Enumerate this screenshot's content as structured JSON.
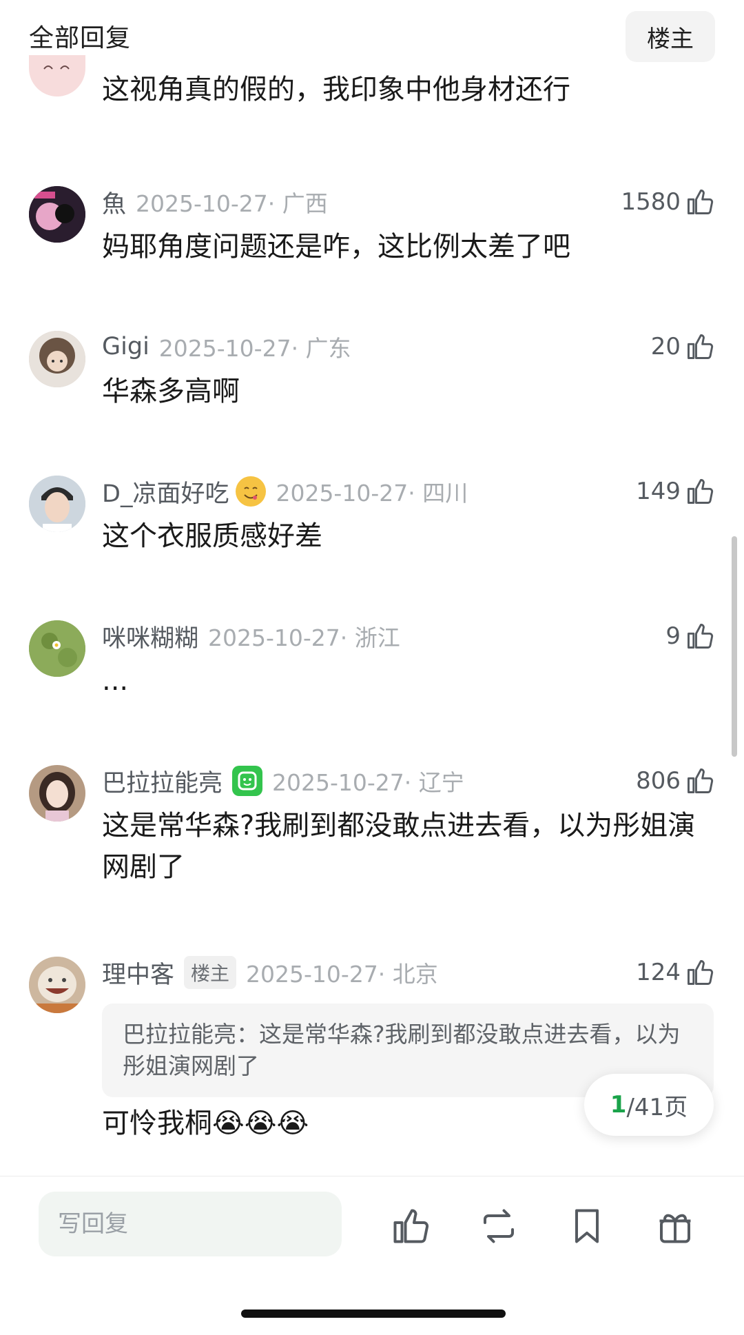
{
  "header": {
    "title": "全部回复",
    "filter_label": "楼主"
  },
  "comments": [
    {
      "text": "这视角真的假的，我印象中他身材还行"
    },
    {
      "name": "魚",
      "meta": "2025-10-27· 广西",
      "likes": "1580",
      "text": "妈耶角度问题还是咋，这比例太差了吧"
    },
    {
      "name": "Gigi",
      "meta": "2025-10-27· 广东",
      "likes": "20",
      "text": "华森多高啊"
    },
    {
      "name": "D_凉面好吃",
      "meta": "2025-10-27· 四川",
      "likes": "149",
      "text": "这个衣服质感好差"
    },
    {
      "name": "咪咪糊糊",
      "meta": "2025-10-27· 浙江",
      "likes": "9",
      "text": "..."
    },
    {
      "name": "巴拉拉能亮",
      "meta": "2025-10-27· 辽宁",
      "likes": "806",
      "text": "这是常华森?我刷到都没敢点进去看，以为彤姐演网剧了"
    },
    {
      "name": "理中客",
      "badge": "楼主",
      "meta": "2025-10-27· 北京",
      "likes": "124",
      "quote": "巴拉拉能亮：这是常华森?我刷到都没敢点进去看，以为彤姐演网剧了",
      "text": "可怜我桐😭😭😭"
    }
  ],
  "pager": {
    "current": "1",
    "total": "/41页"
  },
  "bottom_bar": {
    "reply_placeholder": "写回复"
  },
  "colors": {
    "accent": "#1aa34a",
    "meta_gray": "#a8acb0"
  }
}
